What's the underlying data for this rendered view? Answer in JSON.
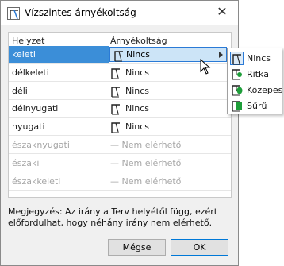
{
  "window": {
    "title": "Vízszintes árnyékoltság",
    "close_glyph": "✕",
    "app_icon": "shading-app-icon"
  },
  "table": {
    "headers": {
      "direction": "Helyzet",
      "shading": "Árnyékoltság"
    },
    "rows": [
      {
        "direction": "keleti",
        "shading": "Nincs",
        "state": "selected"
      },
      {
        "direction": "délkeleti",
        "shading": "Nincs",
        "state": "enabled"
      },
      {
        "direction": "déli",
        "shading": "Nincs",
        "state": "enabled"
      },
      {
        "direction": "délnyugati",
        "shading": "Nincs",
        "state": "enabled"
      },
      {
        "direction": "nyugati",
        "shading": "Nincs",
        "state": "enabled"
      },
      {
        "direction": "északnyugati",
        "shading": "— Nem elérhető",
        "state": "disabled"
      },
      {
        "direction": "északi",
        "shading": "— Nem elérhető",
        "state": "disabled"
      },
      {
        "direction": "északkeleti",
        "shading": "— Nem elérhető",
        "state": "disabled"
      }
    ]
  },
  "note": "Megjegyzés: Az irány a Terv helyétől függ, ezért előfordulhat, hogy néhány irány nem elérhető.",
  "buttons": {
    "cancel": "Mégse",
    "ok": "OK"
  },
  "popup_menu": {
    "items": [
      {
        "label": "Nincs",
        "icon": "shading-none-icon",
        "current": true
      },
      {
        "label": "Ritka",
        "icon": "shading-sparse-icon",
        "current": false
      },
      {
        "label": "Közepes",
        "icon": "shading-medium-icon",
        "current": false
      },
      {
        "label": "Sűrű",
        "icon": "shading-dense-icon",
        "current": false
      }
    ]
  },
  "colors": {
    "selection": "#3b8ed8",
    "cell_highlight": "#cce4f7",
    "cell_border": "#2a7ad6",
    "foliage_green": "#1e9e3a",
    "disabled_text": "#a6a6a6"
  }
}
